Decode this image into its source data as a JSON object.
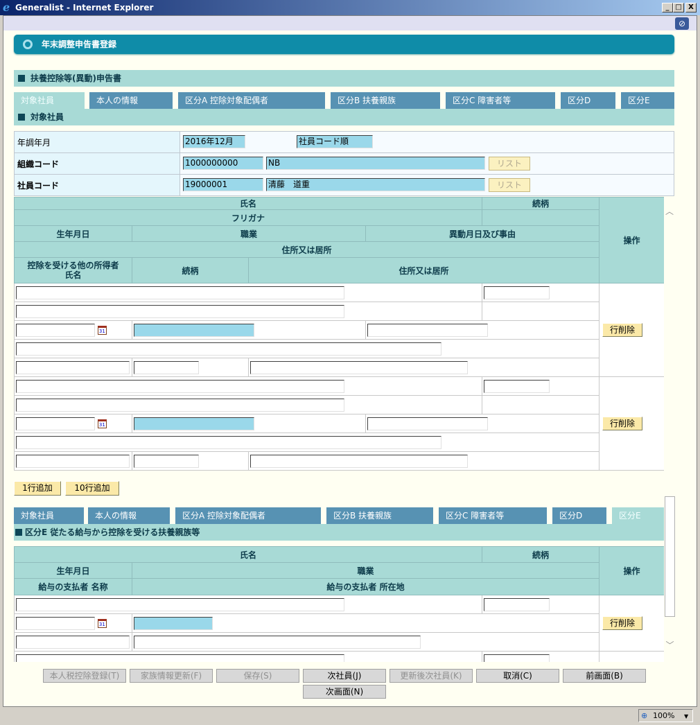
{
  "window": {
    "title": "Generalist - Internet Explorer",
    "min": "_",
    "max": "□",
    "close": "X"
  },
  "banner": {
    "title": "年末調整申告書登録"
  },
  "section1": {
    "title": "扶養控除等(異動)申告書",
    "subtitle": "対象社員"
  },
  "tabs1": [
    "対象社員",
    "本人の情報",
    "区分A 控除対象配偶者",
    "区分B 扶養親族",
    "区分C 障害者等",
    "区分D",
    "区分E"
  ],
  "info": {
    "rows": [
      {
        "label": "年調年月",
        "value": "2016年12月",
        "extra": "社員コード順"
      },
      {
        "label": "組織コード",
        "value": "1000000000",
        "name": "NB",
        "button": "リスト"
      },
      {
        "label": "社員コード",
        "value": "19000001",
        "name": "清藤　道重",
        "button": "リスト"
      }
    ]
  },
  "grid1": {
    "headers": {
      "name": "氏名",
      "relation": "続柄",
      "furigana": "フリガナ",
      "action": "操作",
      "birth": "生年月日",
      "job": "職業",
      "change": "異動月日及び事由",
      "address": "住所又は居所",
      "other_earner": "控除を受ける他の所得者\n氏名",
      "other_relation": "続柄",
      "other_address": "住所又は居所"
    },
    "delete_label": "行削除"
  },
  "add_buttons": {
    "one": "1行追加",
    "ten": "10行追加"
  },
  "section2": {
    "title": "区分E 従たる給与から控除を受ける扶養親族等"
  },
  "grid2": {
    "headers": {
      "name": "氏名",
      "relation": "続柄",
      "action": "操作",
      "birth": "生年月日",
      "job": "職業",
      "payer_name": "給与の支払者 名称",
      "payer_address": "給与の支払者 所在地"
    },
    "delete_label": "行削除"
  },
  "footer_buttons": [
    "本人税控除登録(T)",
    "家族情報更新(F)",
    "保存(S)",
    "次社員(J)",
    "更新後次社員(K)",
    "取消(C)",
    "前画面(B)",
    "次画面(N)"
  ],
  "statusbar": {
    "zoom": "100%"
  },
  "calendar_icon_text": "31"
}
